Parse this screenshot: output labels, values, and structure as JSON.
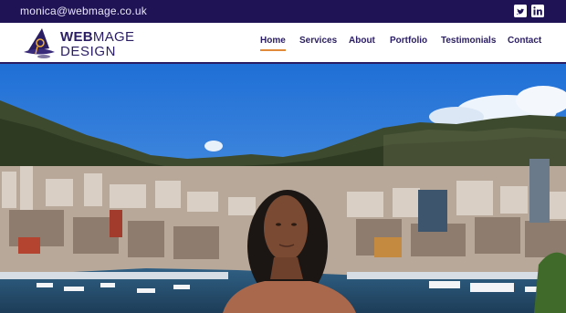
{
  "topbar": {
    "email": "monica@webmage.co.uk",
    "social": [
      {
        "name": "twitter-icon"
      },
      {
        "name": "linkedin-icon"
      }
    ]
  },
  "logo": {
    "line1_bold": "WEB",
    "line1_light": "MAGE",
    "line2": "DESIGN"
  },
  "nav": {
    "items": [
      {
        "label": "Home",
        "active": true
      },
      {
        "label": "Services",
        "active": false
      },
      {
        "label": "About",
        "active": false
      },
      {
        "label": "Portfolio",
        "active": false
      },
      {
        "label": "Testimonials",
        "active": false
      },
      {
        "label": "Contact",
        "active": false
      }
    ]
  },
  "colors": {
    "brand": "#2a1d63",
    "topbar": "#1f1356",
    "accent": "#e08a3a"
  }
}
